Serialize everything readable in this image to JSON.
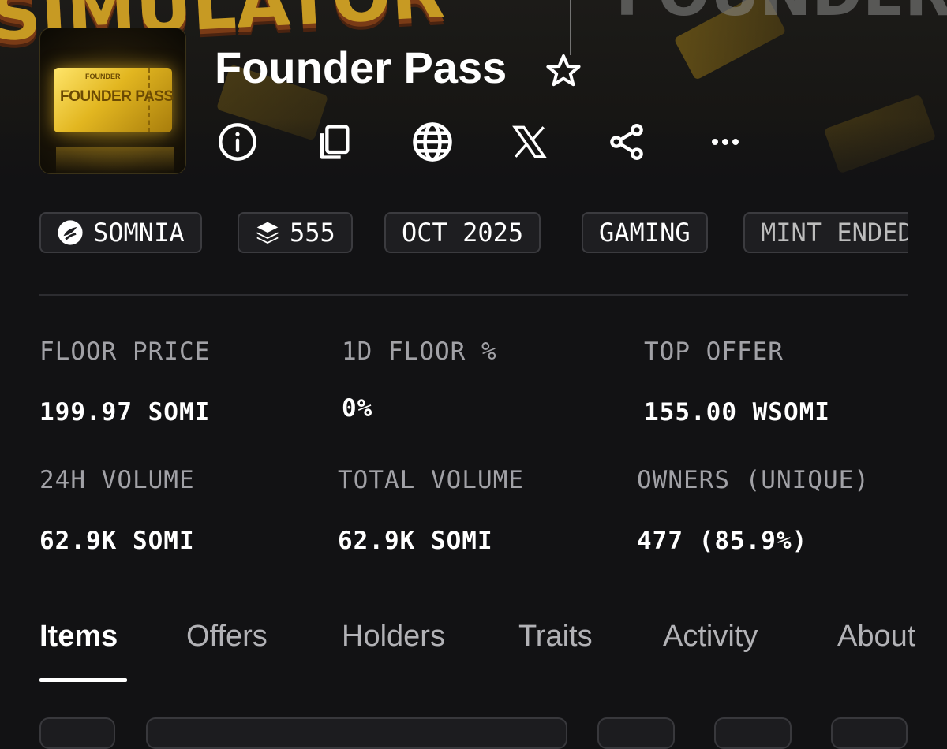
{
  "banner": {
    "word_left": "SIMULATOR",
    "word_right": "FOUNDER"
  },
  "collection": {
    "title": "Founder Pass",
    "thumbnail_text": "FOUNDER PASS",
    "thumbnail_small_text": "FOUNDER",
    "favorite_icon": "star-outline-icon"
  },
  "actions": [
    {
      "name": "info",
      "icon": "info-circle-icon"
    },
    {
      "name": "copy",
      "icon": "copy-icon"
    },
    {
      "name": "website",
      "icon": "globe-icon"
    },
    {
      "name": "x",
      "icon": "x-logo-icon"
    },
    {
      "name": "share",
      "icon": "share-icon"
    },
    {
      "name": "more",
      "icon": "more-horizontal-icon"
    }
  ],
  "chips": {
    "chain": "SOMNIA",
    "supply": "555",
    "date": "OCT 2025",
    "category": "GAMING",
    "status": "MINT ENDED"
  },
  "stats": {
    "floor_price_label": "FLOOR PRICE",
    "floor_price_value": "199.97 SOMI",
    "floor_change_label": "1D FLOOR %",
    "floor_change_value": "0%",
    "top_offer_label": "TOP OFFER",
    "top_offer_value": "155.00 WSOMI",
    "volume_24h_label": "24H VOLUME",
    "volume_24h_value": "62.9K SOMI",
    "total_volume_label": "TOTAL VOLUME",
    "total_volume_value": "62.9K SOMI",
    "owners_label": "OWNERS (UNIQUE)",
    "owners_value": "477 (85.9%)"
  },
  "tabs": {
    "items": "Items",
    "offers": "Offers",
    "holders": "Holders",
    "traits": "Traits",
    "activity": "Activity",
    "about": "About",
    "active": "Items"
  },
  "colors": {
    "background": "#121214",
    "chip_border": "#3b3b3f",
    "label_gray": "#a1a1a6",
    "gold": "#e2b620"
  }
}
